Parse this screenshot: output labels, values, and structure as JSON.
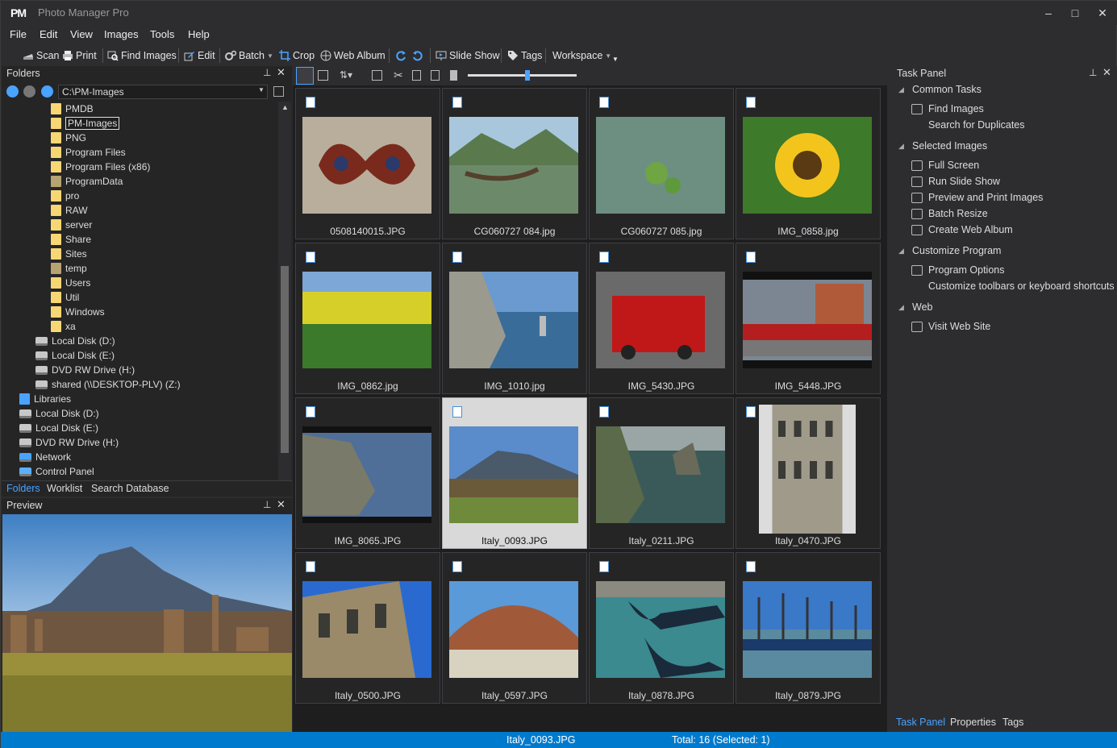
{
  "app": {
    "logo": "PM",
    "title": "Photo Manager Pro"
  },
  "window": {
    "minimize": "–",
    "maximize": "□",
    "close": "✕"
  },
  "menu": [
    "File",
    "Edit",
    "View",
    "Images",
    "Tools",
    "Help"
  ],
  "toolbar": {
    "scan": "Scan",
    "print": "Print",
    "find": "Find Images",
    "edit": "Edit",
    "batch": "Batch",
    "crop": "Crop",
    "webalbum": "Web Album",
    "slideshow": "Slide Show",
    "tags": "Tags",
    "workspace": "Workspace"
  },
  "folders": {
    "title": "Folders",
    "path": "C:\\PM-Images",
    "items": [
      "PMDB",
      "PM-Images",
      "PNG",
      "Program Files",
      "Program Files (x86)",
      "ProgramData",
      "pro",
      "RAW",
      "server",
      "Share",
      "Sites",
      "temp",
      "Users",
      "Util",
      "Windows",
      "xa",
      "Local Disk (D:)",
      "Local Disk (E:)",
      "DVD RW Drive (H:)",
      "shared (\\\\DESKTOP-PLV) (Z:)",
      "Libraries",
      "Local Disk (D:)",
      "Local Disk (E:)",
      "DVD RW Drive (H:)",
      "Network",
      "Control Panel"
    ],
    "tabs": [
      "Folders",
      "Worklist",
      "Search Database"
    ]
  },
  "preview": {
    "title": "Preview"
  },
  "zoom": {
    "level": 0.55
  },
  "images": [
    "0508140015.JPG",
    "CG060727 084.jpg",
    "CG060727 085.jpg",
    "IMG_0858.jpg",
    "IMG_0862.jpg",
    "IMG_1010.jpg",
    "IMG_5430.JPG",
    "IMG_5448.JPG",
    "IMG_8065.JPG",
    "Italy_0093.JPG",
    "Italy_0211.JPG",
    "Italy_0470.JPG",
    "Italy_0500.JPG",
    "Italy_0597.JPG",
    "Italy_0878.JPG",
    "Italy_0879.JPG"
  ],
  "taskpanel": {
    "title": "Task Panel",
    "sections": [
      {
        "label": "Common Tasks",
        "items": [
          "Find Images",
          "Search for Duplicates"
        ]
      },
      {
        "label": "Selected Images",
        "items": [
          "Full Screen",
          "Run Slide Show",
          "Preview and Print Images",
          "Batch Resize",
          "Create Web Album"
        ]
      },
      {
        "label": "Customize Program",
        "items": [
          "Program Options",
          "Customize toolbars or keyboard shortcuts"
        ]
      },
      {
        "label": "Web",
        "items": [
          "Visit Web Site"
        ]
      }
    ],
    "tabs": [
      "Task Panel",
      "Properties",
      "Tags"
    ]
  },
  "status": {
    "filename": "Italy_0093.JPG",
    "total": "Total: 16 (Selected: 1)"
  },
  "colors": {
    "accent": "#007acc",
    "folder": "#f7d774"
  }
}
